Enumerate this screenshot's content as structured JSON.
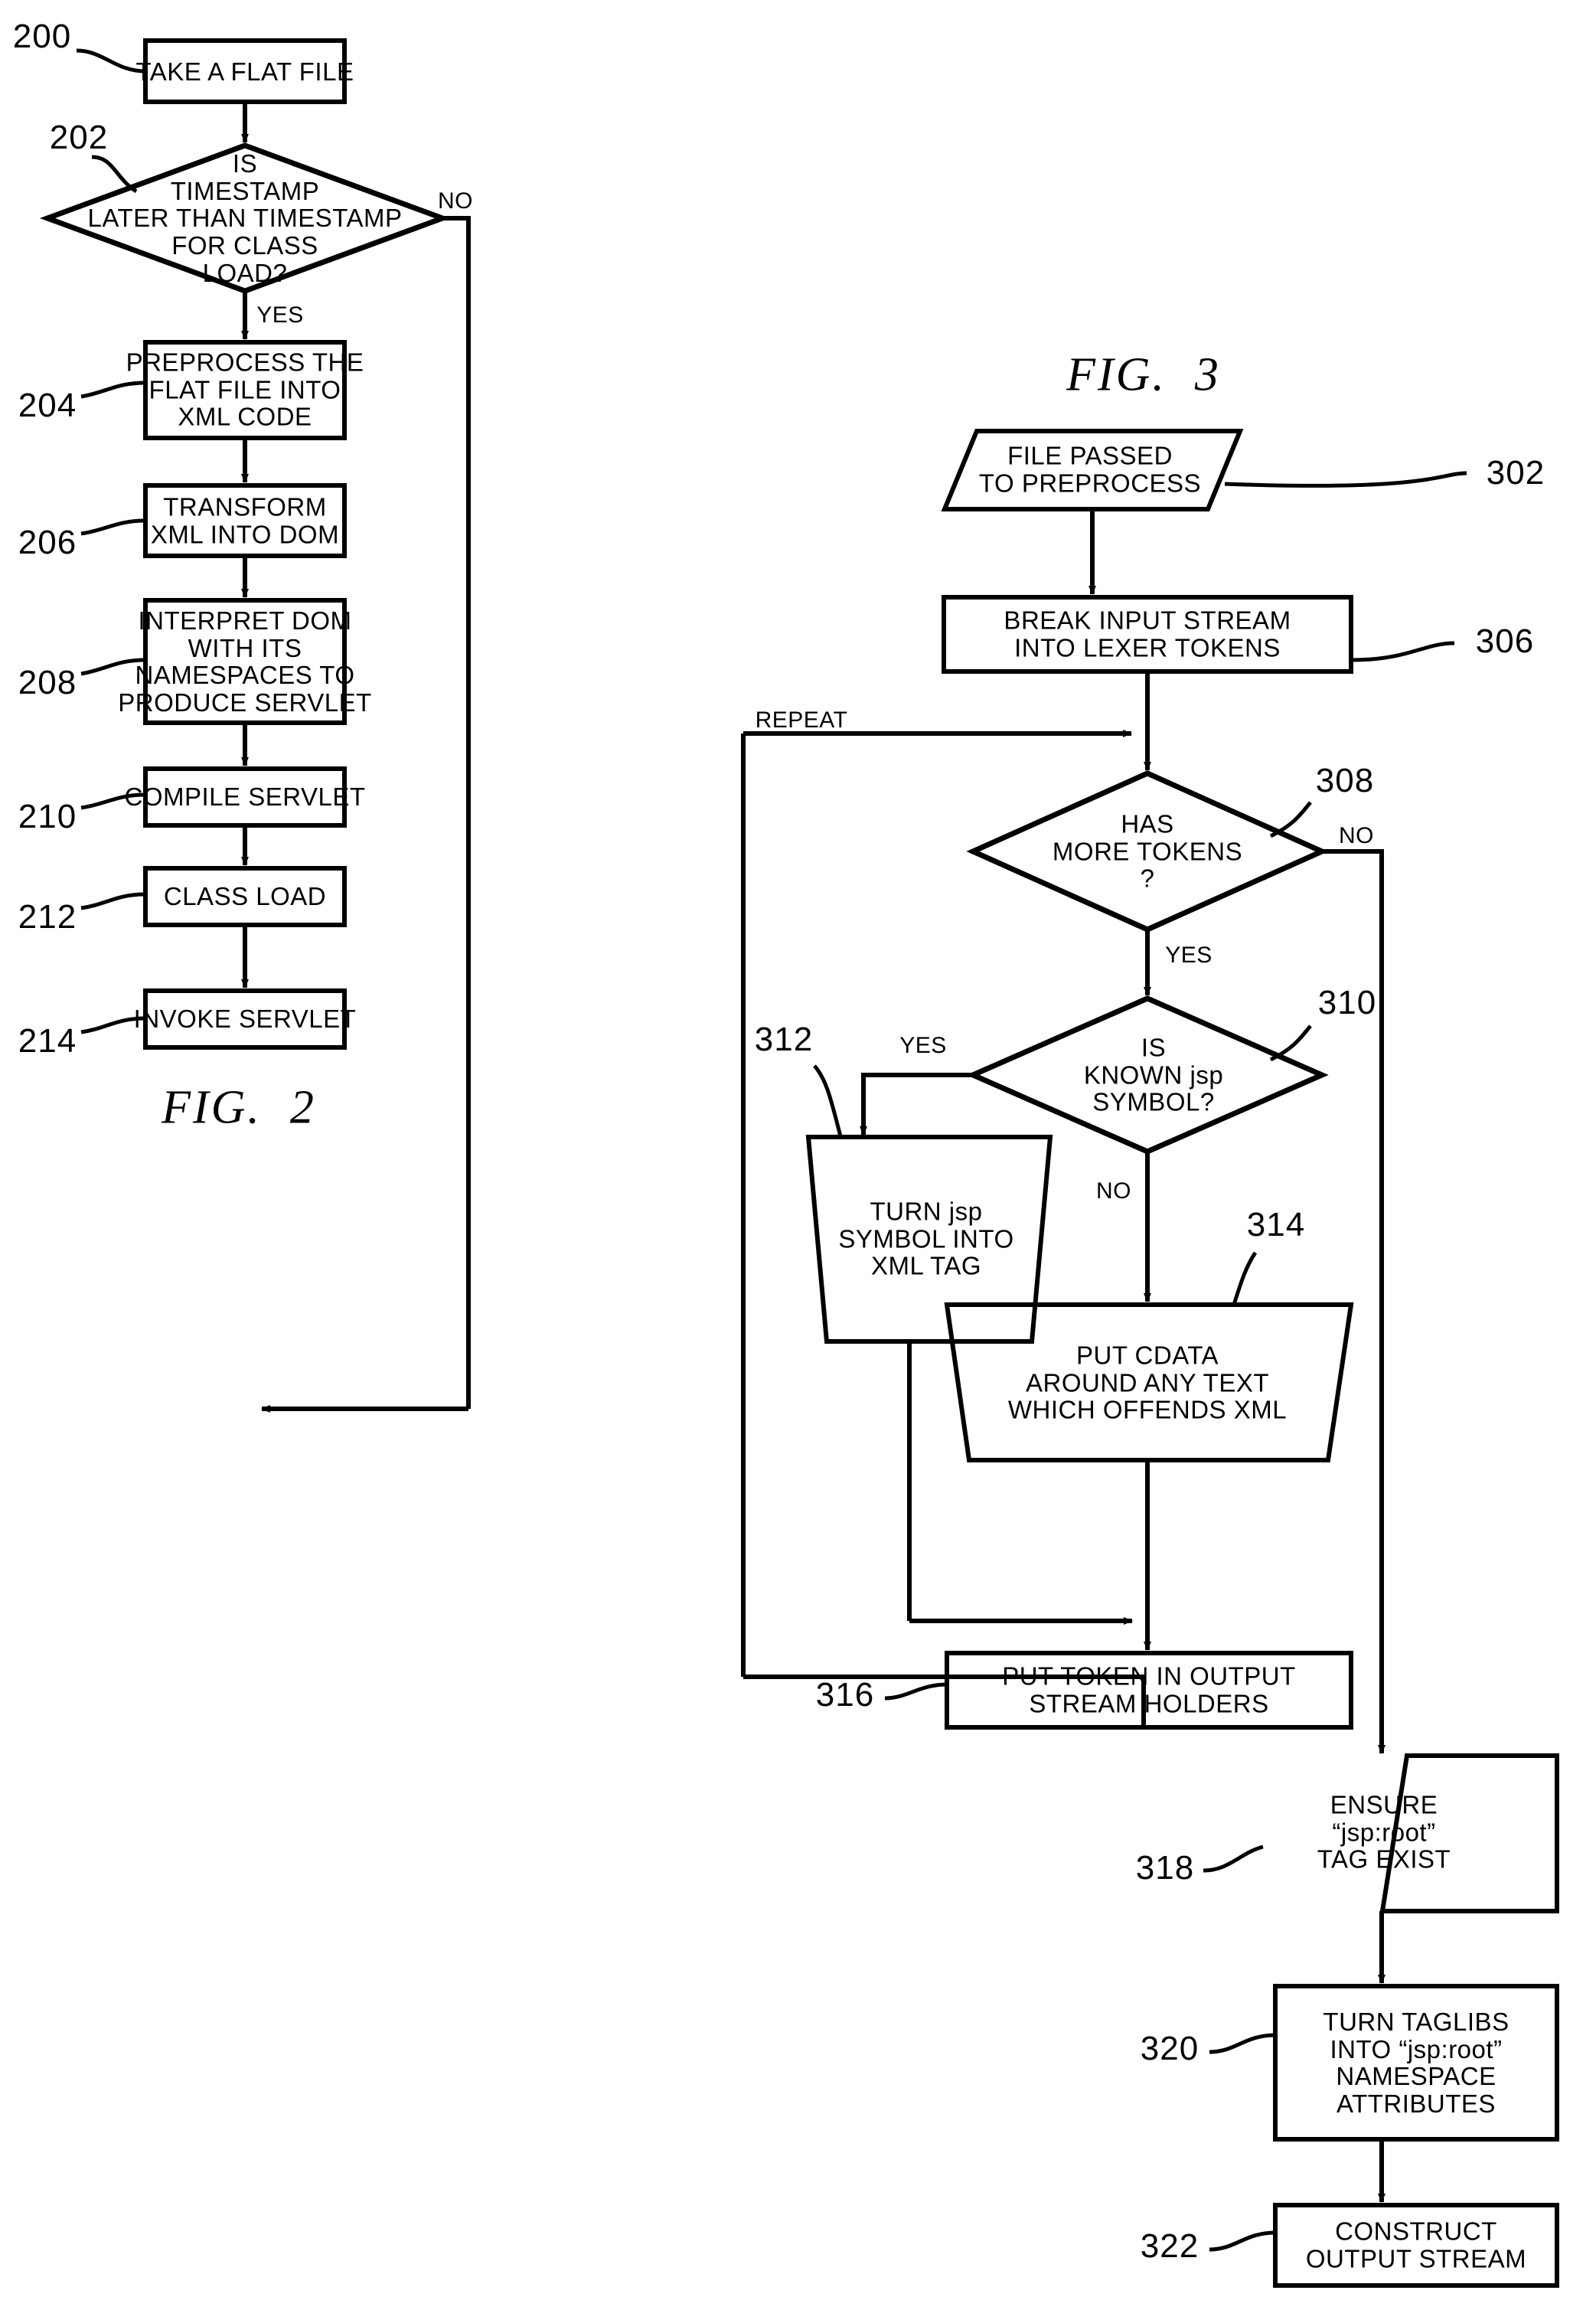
{
  "figures": [
    {
      "id": "fig2",
      "caption": "FIG.  2",
      "nodes": [
        {
          "ref": "200",
          "shape": "rect",
          "text": "TAKE A FLAT FILE"
        },
        {
          "ref": "202",
          "shape": "diamond",
          "text": "IS\nTIMESTAMP\nLATER THAN TIMESTAMP\nFOR CLASS\nLOAD?"
        },
        {
          "ref": "204",
          "shape": "rect",
          "text": "PREPROCESS THE\nFLAT FILE INTO\nXML CODE"
        },
        {
          "ref": "206",
          "shape": "rect",
          "text": "TRANSFORM\nXML INTO DOM"
        },
        {
          "ref": "208",
          "shape": "rect",
          "text": "INTERPRET DOM\nWITH ITS\nNAMESPACES TO\nPRODUCE SERVLET"
        },
        {
          "ref": "210",
          "shape": "rect",
          "text": "COMPILE SERVLET"
        },
        {
          "ref": "212",
          "shape": "rect",
          "text": "CLASS LOAD"
        },
        {
          "ref": "214",
          "shape": "rect",
          "text": "INVOKE SERVLET"
        }
      ],
      "edge_labels": [
        {
          "name": "no-202",
          "text": "NO"
        },
        {
          "name": "yes-202",
          "text": "YES"
        }
      ]
    },
    {
      "id": "fig3",
      "caption": "FIG.  3",
      "nodes": [
        {
          "ref": "302",
          "shape": "parallelogram",
          "text": "FILE PASSED\nTO PREPROCESS"
        },
        {
          "ref": "306",
          "shape": "rect",
          "text": "BREAK INPUT STREAM\nINTO LEXER TOKENS"
        },
        {
          "ref": "308",
          "shape": "diamond",
          "text": "HAS\nMORE TOKENS\n?"
        },
        {
          "ref": "310",
          "shape": "diamond",
          "text": "IS\nKNOWN jsp\nSYMBOL?"
        },
        {
          "ref": "312",
          "shape": "trapezoid",
          "text": "TURN jsp\nSYMBOL INTO\nXML TAG"
        },
        {
          "ref": "314",
          "shape": "trapezoid",
          "text": "PUT CDATA\nAROUND ANY TEXT\nWHICH OFFENDS XML"
        },
        {
          "ref": "316",
          "shape": "rect",
          "text": "PUT TOKEN IN OUTPUT\nSTREAM HOLDERS"
        },
        {
          "ref": "318",
          "shape": "trapezoid",
          "text": "ENSURE\n“jsp:root”\nTAG EXIST"
        },
        {
          "ref": "320",
          "shape": "rect",
          "text": "TURN TAGLIBS\nINTO “jsp:root”\nNAMESPACE\nATTRIBUTES"
        },
        {
          "ref": "322",
          "shape": "rect",
          "text": "CONSTRUCT\nOUTPUT STREAM"
        }
      ],
      "edge_labels": [
        {
          "name": "repeat",
          "text": "REPEAT"
        },
        {
          "name": "no-308",
          "text": "NO"
        },
        {
          "name": "yes-308",
          "text": "YES"
        },
        {
          "name": "yes-310",
          "text": "YES"
        },
        {
          "name": "no-310",
          "text": "NO"
        }
      ]
    }
  ],
  "colors": {
    "ink": "#000000",
    "paper": "#ffffff"
  }
}
